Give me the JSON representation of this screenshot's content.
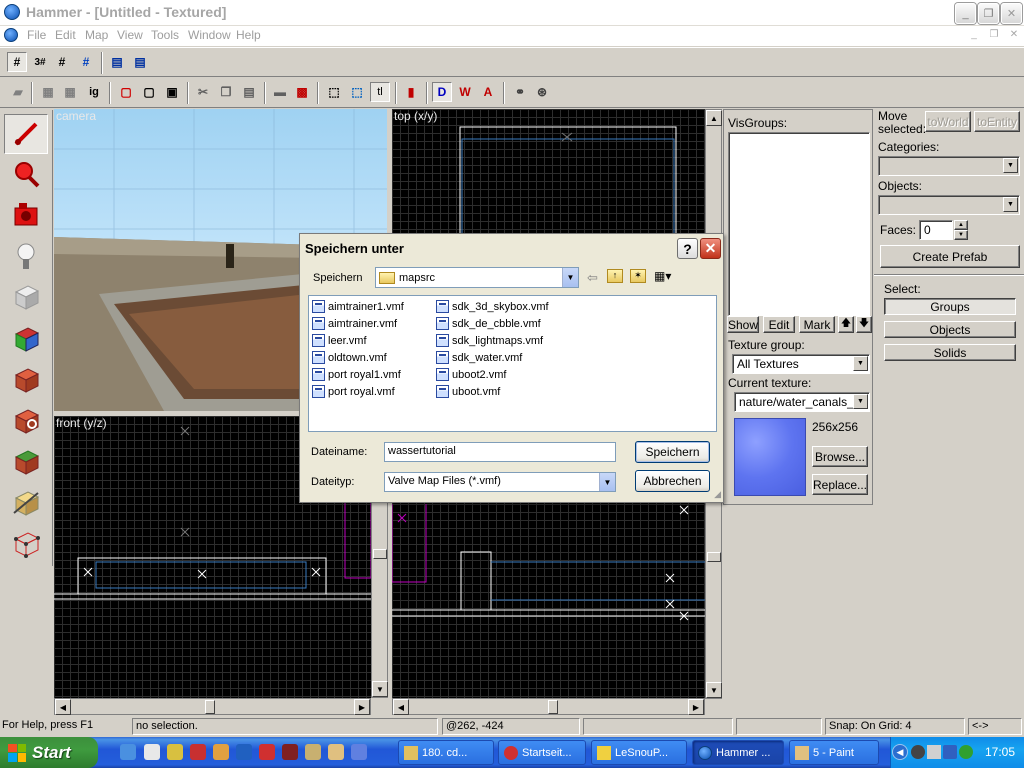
{
  "window": {
    "title": "Hammer - [Untitled - Textured]",
    "minimize": "_",
    "restore": "❐",
    "close": "✕"
  },
  "menu": {
    "items": [
      "File",
      "Edit",
      "Map",
      "View",
      "Tools",
      "Window",
      "Help"
    ]
  },
  "viewports": {
    "camera": "camera",
    "top": "top (x/y)",
    "front": "front (y/z)"
  },
  "visgroups": {
    "label": "VisGroups:",
    "show": "Show",
    "edit": "Edit",
    "mark": "Mark",
    "up": "🡅",
    "down": "🡇"
  },
  "texture": {
    "group_label": "Texture group:",
    "group_value": "All Textures",
    "current_label": "Current texture:",
    "current_value": "nature/water_canals_w",
    "size": "256x256",
    "browse": "Browse...",
    "replace": "Replace...",
    "swatch_color": "#5e74f0"
  },
  "object_panel": {
    "move_selected": "Move selected:",
    "to_world": "toWorld",
    "to_entity": "toEntity",
    "categories_label": "Categories:",
    "objects_label": "Objects:",
    "faces_label": "Faces:",
    "faces_value": "0",
    "create_prefab": "Create Prefab"
  },
  "select_panel": {
    "label": "Select:",
    "groups": "Groups",
    "objects": "Objects",
    "solids": "Solids"
  },
  "dialog": {
    "title": "Speichern unter",
    "help": "?",
    "close": "✕",
    "save_in_label": "Speichern",
    "save_in_value": "mapsrc",
    "files_col1": [
      "aimtrainer1.vmf",
      "aimtrainer.vmf",
      "leer.vmf",
      "oldtown.vmf",
      "port royal1.vmf",
      "port royal.vmf"
    ],
    "files_col2": [
      "sdk_3d_skybox.vmf",
      "sdk_de_cbble.vmf",
      "sdk_lightmaps.vmf",
      "sdk_water.vmf",
      "uboot2.vmf",
      "uboot.vmf"
    ],
    "filename_label": "Dateiname:",
    "filename_value": "wassertutorial",
    "filetype_label": "Dateityp:",
    "filetype_value": "Valve Map Files (*.vmf)",
    "save_button": "Speichern",
    "cancel_button": "Abbrechen"
  },
  "status": {
    "help": "For Help, press F1",
    "selection": "no selection.",
    "coords": "@262, -424",
    "snap": "Snap: On Grid: 4",
    "arrows": "<->"
  },
  "taskbar": {
    "start": "Start",
    "tasks": [
      "180. cd...",
      "Startseit...",
      "LeSnouP...",
      "Hammer ...",
      "5 - Paint"
    ],
    "active_task": 3,
    "clock": "17:05"
  },
  "colors": {
    "xp_blue": "#245edb",
    "start_green": "#3c8f3c",
    "selection_red": "#ff0000",
    "brush_white": "#ffffff",
    "brush_magenta": "#c000c0"
  }
}
